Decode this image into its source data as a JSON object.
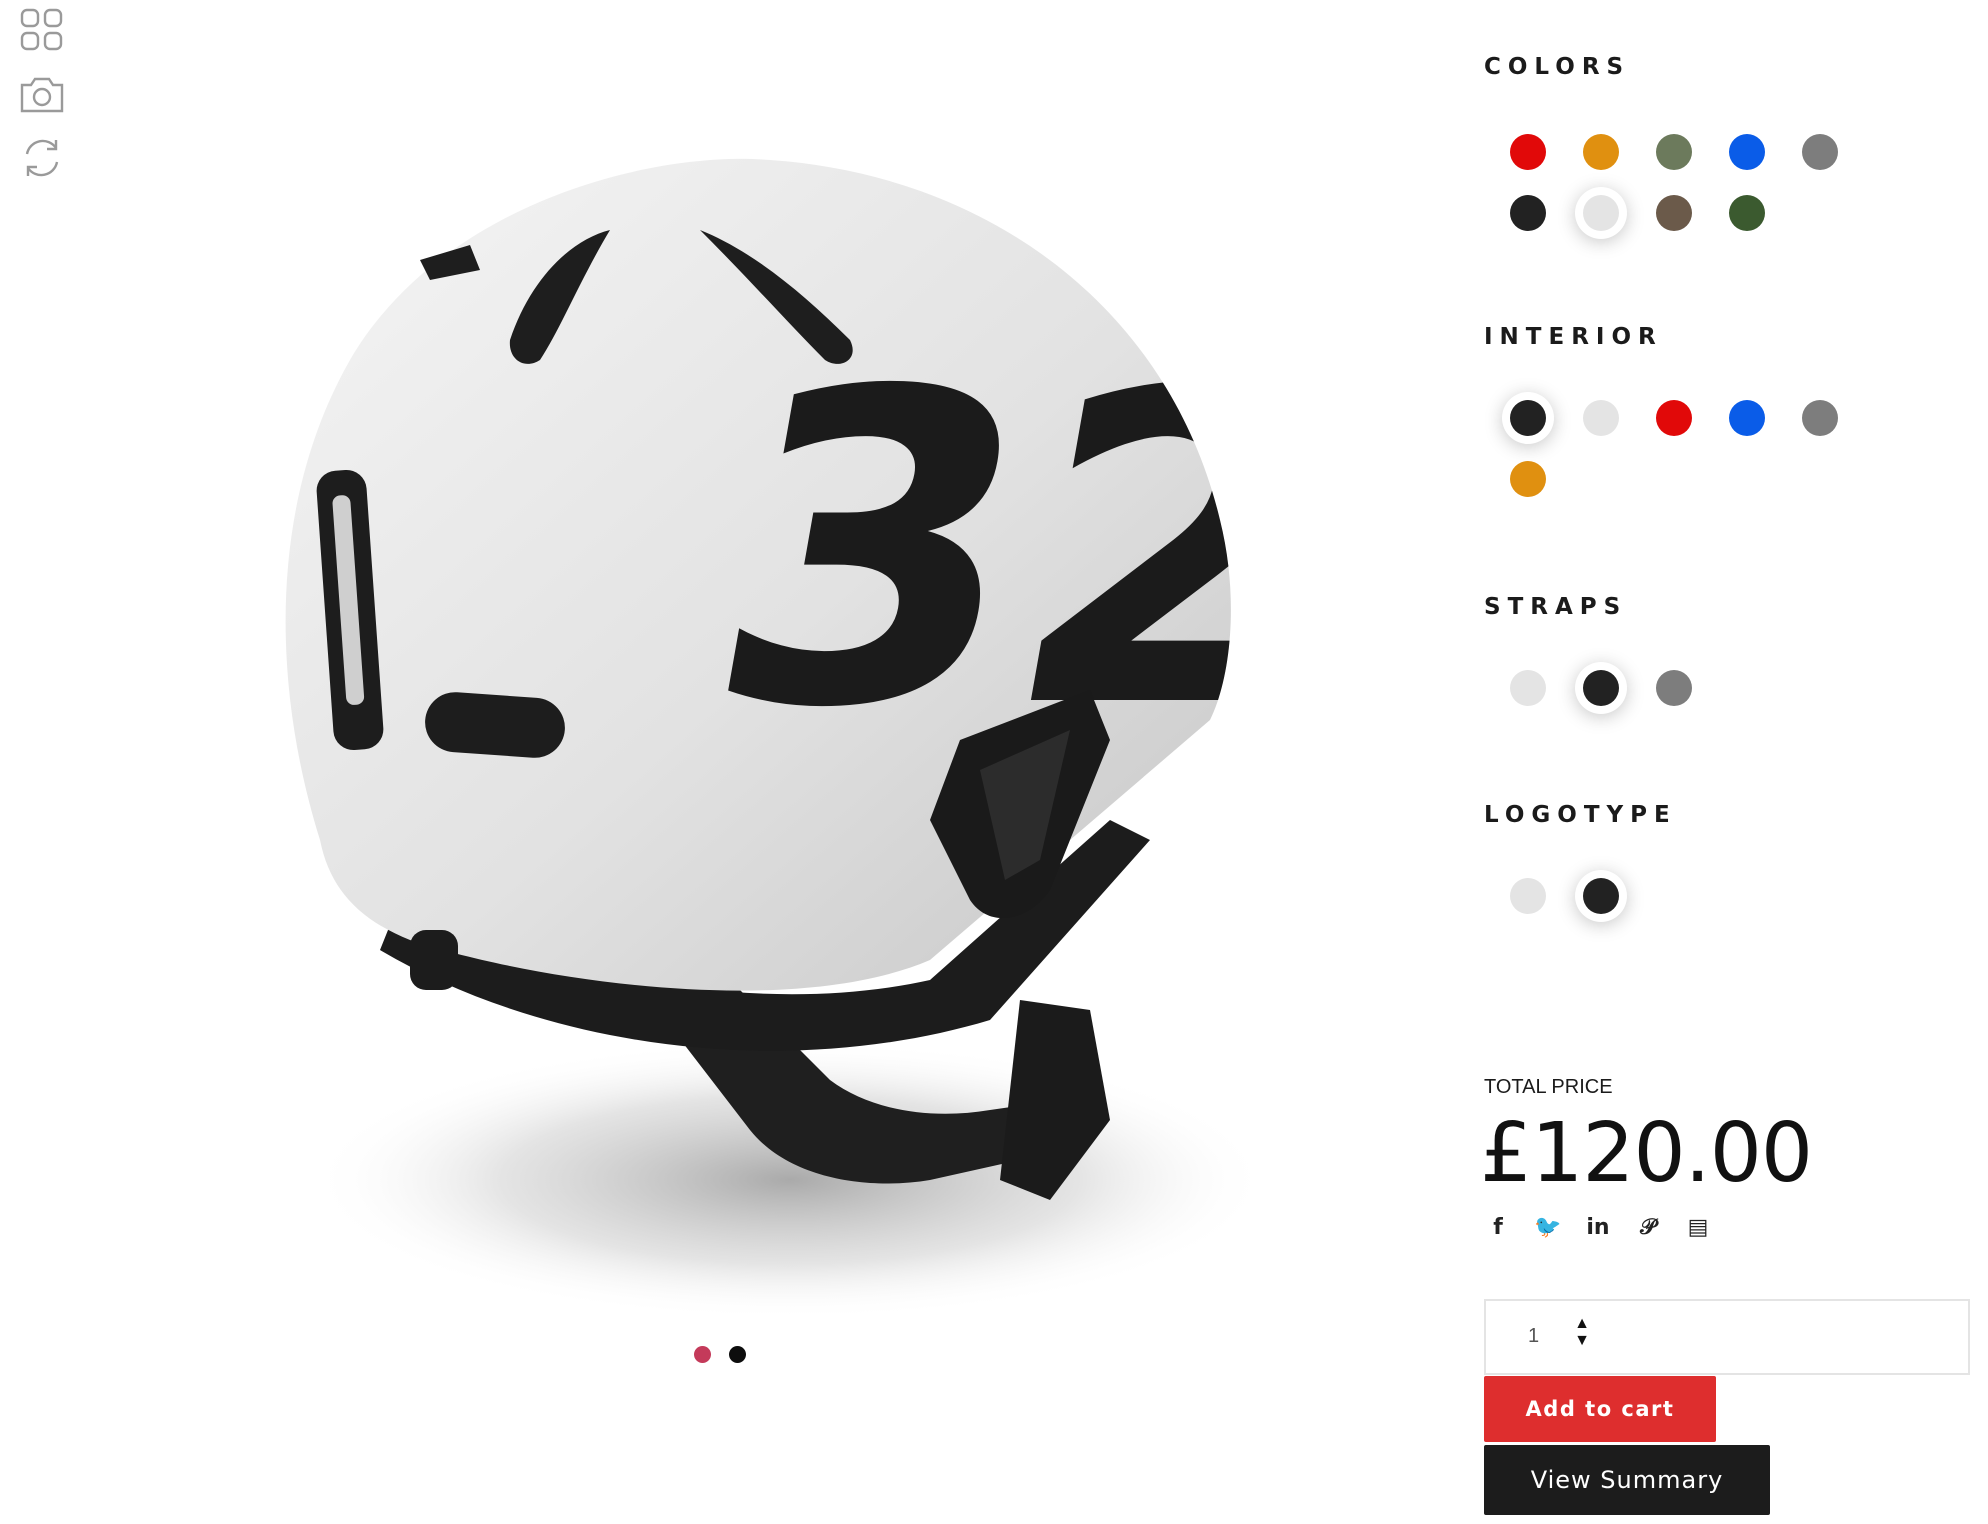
{
  "toolbar": {
    "items": [
      {
        "icon": "grid-icon"
      },
      {
        "icon": "camera-icon"
      },
      {
        "icon": "rotate-icon"
      }
    ]
  },
  "product": {
    "decal_number": "32",
    "helmet_color": "#e3e3e3",
    "decal_color": "#1b1b1b"
  },
  "carousel": {
    "active_index": 1,
    "dot_colors": [
      "#c43a5a",
      "#0d0d0d"
    ]
  },
  "options": {
    "colors": {
      "title": "COLORS",
      "swatches": [
        "#e10909",
        "#e09010",
        "#6c7a5c",
        "#0a5ce8",
        "#7d7d7d",
        "#222222",
        "#e4e4e4",
        "#6b5a4a",
        "#3b5a2f"
      ],
      "selected_index": 6
    },
    "interior": {
      "title": "INTERIOR",
      "swatches": [
        "#222222",
        "#e4e4e4",
        "#e10909",
        "#0a5ce8",
        "#7d7d7d",
        "#e09010"
      ],
      "selected_index": 0
    },
    "straps": {
      "title": "STRAPS",
      "swatches": [
        "#e4e4e4",
        "#222222",
        "#7d7d7d"
      ],
      "selected_index": 1
    },
    "logotype": {
      "title": "LOGOTYPE",
      "swatches": [
        "#e4e4e4",
        "#222222"
      ],
      "selected_index": 1
    }
  },
  "pricing": {
    "label": "TOTAL PRICE",
    "amount": "£120.00"
  },
  "share": {
    "icons": [
      "facebook-icon",
      "twitter-icon",
      "linkedin-icon",
      "pinterest-icon",
      "pdf-icon"
    ],
    "labels": [
      "f",
      "🐦",
      "in",
      "𝒫",
      "▤"
    ]
  },
  "cart": {
    "quantity": "1",
    "add_label": "Add to cart",
    "summary_label": "View Summary",
    "accent": "#de2e2e"
  }
}
